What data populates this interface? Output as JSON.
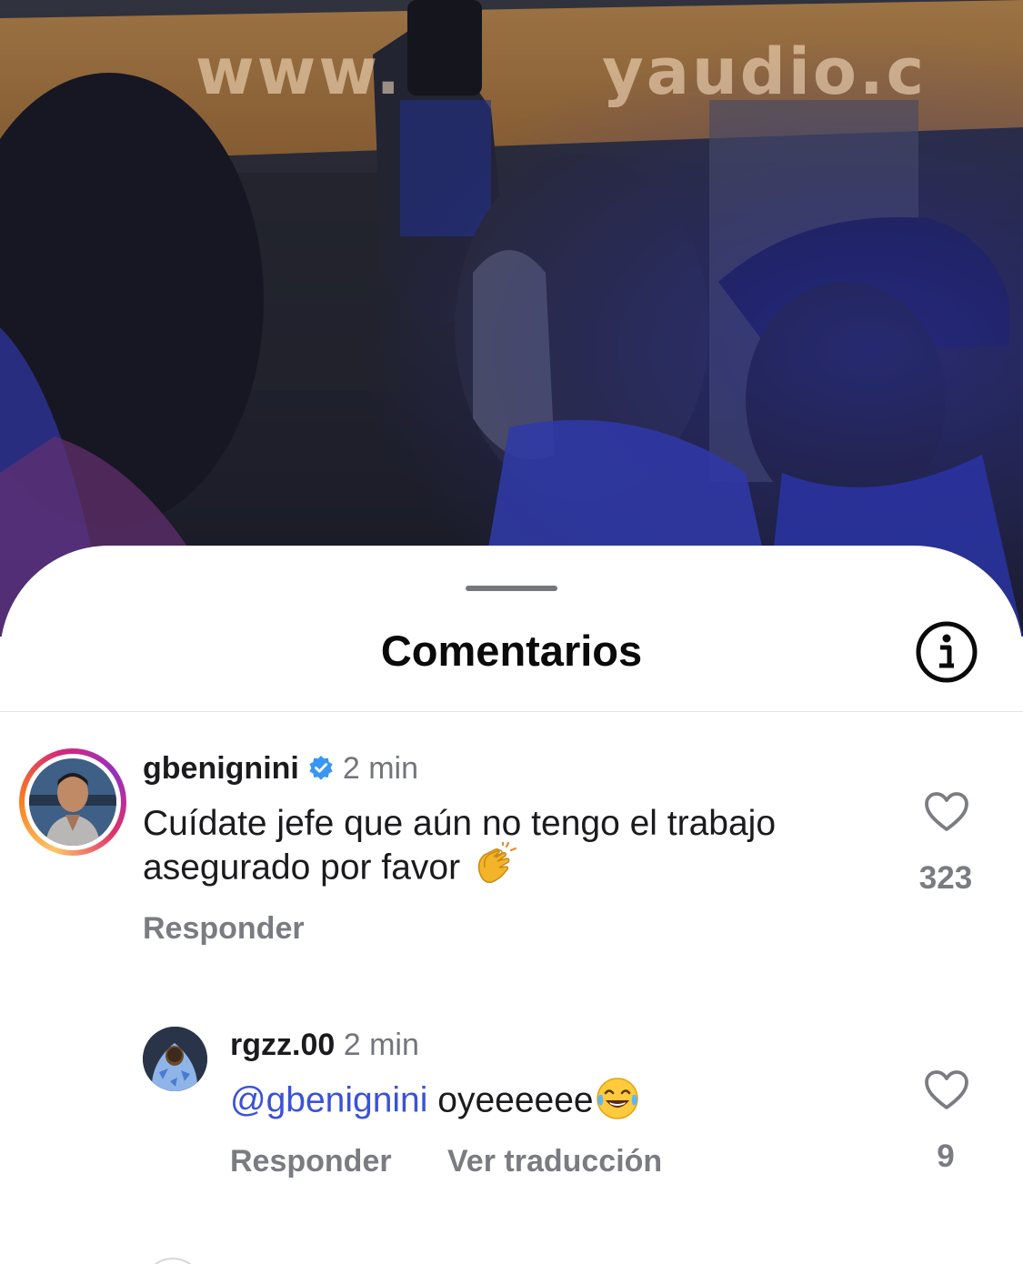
{
  "video": {
    "banner_text": "www.        yaudio.c"
  },
  "sheet": {
    "title": "Comentarios",
    "info_icon": "info-icon"
  },
  "comments": [
    {
      "username": "gbenignini",
      "verified": true,
      "time": "2 min",
      "text": "Cuídate jefe que aún no tengo el trabajo asegurado por favor",
      "emoji": "clapping-hands",
      "reply_label": "Responder",
      "likes": "323",
      "has_story_ring": true
    },
    {
      "username": "rgzz.00",
      "verified": false,
      "time": "2 min",
      "mention": "@gbenignini",
      "text": "oyeeeeee",
      "emoji": "tears-of-joy",
      "reply_label": "Responder",
      "translate_label": "Ver traducción",
      "likes": "9",
      "has_story_ring": false
    }
  ]
}
